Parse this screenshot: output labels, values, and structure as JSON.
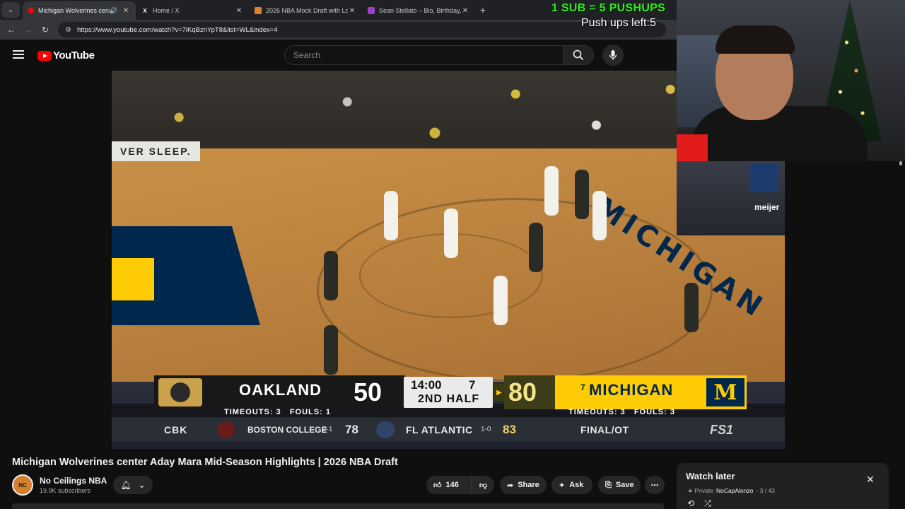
{
  "browser": {
    "tabs": [
      {
        "title": "Michigan Wolverines cente",
        "active": true,
        "icon": "youtube-icon",
        "audio": true
      },
      {
        "title": "Home / X",
        "active": false,
        "icon": "x-icon"
      },
      {
        "title": "2026 NBA Mock Draft with Lott",
        "active": false,
        "icon": "article-icon"
      },
      {
        "title": "Sean Stellato – Bio, Birthday, Ag",
        "active": false,
        "icon": "site-icon"
      }
    ],
    "url": "https://www.youtube.com/watch?v=7lKqBznYpT8&list=WL&index=4"
  },
  "youtube": {
    "logo_text": "YouTube",
    "search_placeholder": "Search"
  },
  "overlay": {
    "promo": "1 SUB = 5 PUSHUPS",
    "pushups_left": "Push ups left:5"
  },
  "scoreboard": {
    "away_team": "OAKLAND",
    "away_score": "50",
    "clock": "14:00",
    "shot_clock": "7",
    "period": "2ND HALF",
    "home_rank": "7",
    "home_team": "MICHIGAN",
    "home_score": "80",
    "home_logo": "M",
    "away_timeouts": "TIMEOUTS: 3   FOULS: 1",
    "home_timeouts": "TIMEOUTS: 3   FOULS: 3",
    "slogan": "VER SLEEP."
  },
  "ticker": {
    "league": "CBK",
    "team1": "BOSTON COLLEGE",
    "team1_record": "0-1",
    "team1_score": "78",
    "team2": "FL ATLANTIC",
    "team2_record": "1-0",
    "team2_score": "83",
    "status": "FINAL/OT",
    "network": "FS1"
  },
  "court": {
    "baseline": "MICHIGAN",
    "sponsor": "meijer"
  },
  "video": {
    "title": "Michigan Wolverines center Aday Mara Mid-Season Highlights | 2026 NBA Draft",
    "channel": "No Ceilings NBA",
    "subscribers": "19.9K subscribers",
    "avatar_text": "NC",
    "likes": "146",
    "share_label": "Share",
    "ask_label": "Ask",
    "save_label": "Save"
  },
  "watch_later": {
    "title": "Watch later",
    "privacy": "Private",
    "owner": "NoCapAlonzo",
    "position": "- 3 / 43"
  },
  "colors": {
    "youtube_red": "#ff0000",
    "michigan_maize": "#ffcb05",
    "michigan_blue": "#00274c",
    "promo_green": "#2cf21a"
  }
}
